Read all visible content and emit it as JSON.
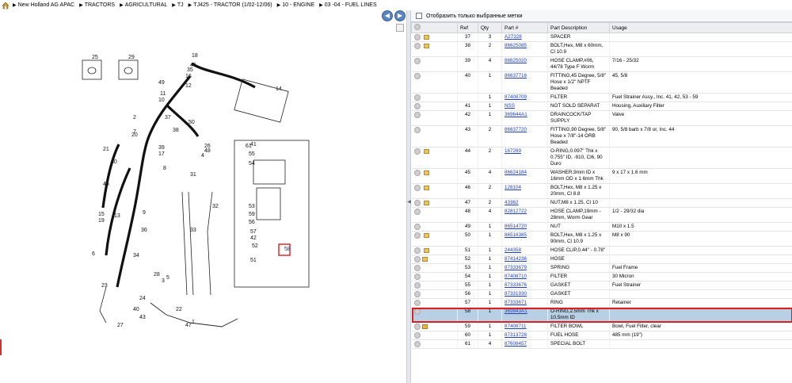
{
  "breadcrumbs": [
    "New Holland AG APAC",
    "TRACTORS",
    "AGRICULTURAL",
    "TJ",
    "TJ425 - TRACTOR (1/02-12/06)",
    "10 - ENGINE",
    "03 -04 - FUEL LINES"
  ],
  "filter": {
    "label": "Отобразить только выбранные метки"
  },
  "table": {
    "headers": [
      "Ref",
      "Qty",
      "Part #",
      "Part Description",
      "Usage"
    ],
    "rows": [
      {
        "icons": [
          "dot",
          "swap",
          "box"
        ],
        "ref": "37",
        "qty": "3",
        "part": "A27328",
        "desc": "SPACER",
        "usage": ""
      },
      {
        "icons": [
          "dot",
          "swap",
          "box"
        ],
        "ref": "38",
        "qty": "2",
        "part": "86625085",
        "desc": "BOLT,Hex, M8 x 60mm, Cl 10.9",
        "usage": ""
      },
      {
        "icons": [
          "dot",
          "arrow"
        ],
        "ref": "39",
        "qty": "4",
        "part": "86625020",
        "desc": "HOSE CLAMP,#06, 44/78 Type F Worm",
        "usage": "7/16 - 25/32"
      },
      {
        "icons": [
          "dot",
          "arrow"
        ],
        "ref": "40",
        "qty": "1",
        "part": "86637716",
        "desc": "FITTING,45 Degree, 5/8\" Hose x 1/2\" NPTF Beaded",
        "usage": "45, 5/8"
      },
      {
        "icons": [
          "dot",
          "arrow"
        ],
        "ref": "",
        "qty": "1",
        "part": "87408709",
        "desc": "FILTER",
        "usage": "Fuel Strainer Assy., Inc. 41, 42, 53 - 59"
      },
      {
        "icons": [
          "dot"
        ],
        "ref": "41",
        "qty": "1",
        "part": "NSS",
        "desc": "NOT SOLD SEPARAT",
        "usage": "Housing, Auxiliary Filter"
      },
      {
        "icons": [
          "dot",
          "swap"
        ],
        "ref": "42",
        "qty": "1",
        "part": "369644A1",
        "desc": "DRAINCOCK/TAP SUPPLY",
        "usage": "Valve"
      },
      {
        "icons": [
          "dot",
          "arrow"
        ],
        "ref": "43",
        "qty": "2",
        "part": "86637720",
        "desc": "FITTING,90 Degree, 5/8\" Hose x 7/8\"-14 ORB Beaded",
        "usage": "90, 5/8 barb x 7/8 or, Inc. 44"
      },
      {
        "icons": [
          "dot",
          "swap",
          "box"
        ],
        "ref": "44",
        "qty": "2",
        "part": "167269",
        "desc": "O-RING,0.097\" Thk x 0.755\" ID, -910, Cl6, 90 Duro",
        "usage": ""
      },
      {
        "icons": [
          "dot",
          "swap",
          "box"
        ],
        "ref": "45",
        "qty": "4",
        "part": "86624184",
        "desc": "WASHER,9mm ID x 16mm OD x 1.6mm Thk",
        "usage": "9 x 17 x 1.6 mm"
      },
      {
        "icons": [
          "dot",
          "swap",
          "box"
        ],
        "ref": "46",
        "qty": "2",
        "part": "128104",
        "desc": "BOLT,Hex, M8 x 1.25 x 20mm, Cl 8.8",
        "usage": ""
      },
      {
        "icons": [
          "dot",
          "swap",
          "box"
        ],
        "ref": "47",
        "qty": "2",
        "part": "43362",
        "desc": "NUT,M8 x 1.25, Cl 10",
        "usage": ""
      },
      {
        "icons": [
          "dot",
          "swap",
          "arrow"
        ],
        "ref": "48",
        "qty": "4",
        "part": "82812722",
        "desc": "HOSE CLAMP,19mm - 28mm, Worm Gear",
        "usage": "1/2 - 29/32 dia"
      },
      {
        "icons": [
          "dot",
          "swap",
          "arrow"
        ],
        "ref": "49",
        "qty": "1",
        "part": "86514720",
        "desc": "NUT",
        "usage": "M10 x 1.5"
      },
      {
        "icons": [
          "dot",
          "swap",
          "box"
        ],
        "ref": "50",
        "qty": "1",
        "part": "86516385",
        "desc": "BOLT,Hex, M8 x 1.25 x 90mm, Cl 10.9",
        "usage": "M8 x 90"
      },
      {
        "icons": [
          "dot",
          "swap",
          "box"
        ],
        "ref": "51",
        "qty": "1",
        "part": "244358",
        "desc": "HOSE CLIP,0.44\" - 0.78\"",
        "usage": ""
      },
      {
        "icons": [
          "dot",
          "box"
        ],
        "ref": "52",
        "qty": "1",
        "part": "87414236",
        "desc": "HOSE",
        "usage": ""
      },
      {
        "icons": [
          "dot"
        ],
        "ref": "53",
        "qty": "1",
        "part": "87333679",
        "desc": "SPRING",
        "usage": "Fuel Frame"
      },
      {
        "icons": [
          "dot",
          "arrow"
        ],
        "ref": "54",
        "qty": "1",
        "part": "87408710",
        "desc": "FILTER",
        "usage": "30 Micron"
      },
      {
        "icons": [
          "dot"
        ],
        "ref": "55",
        "qty": "1",
        "part": "87333676",
        "desc": "GASKET",
        "usage": "Fuel Strainer"
      },
      {
        "icons": [
          "dot"
        ],
        "ref": "56",
        "qty": "1",
        "part": "87331930",
        "desc": "GASKET",
        "usage": ""
      },
      {
        "icons": [
          "dot"
        ],
        "ref": "57",
        "qty": "1",
        "part": "87333671",
        "desc": "RING",
        "usage": "Retainer"
      },
      {
        "icons": [
          "dot",
          "swap"
        ],
        "ref": "58",
        "qty": "1",
        "part": "369843A1",
        "desc": "O-RING,2.5mm Thk x 10.5mm ID",
        "usage": "",
        "selected": true
      },
      {
        "icons": [
          "dot",
          "folder",
          "arrow"
        ],
        "ref": "59",
        "qty": "1",
        "part": "87408711",
        "desc": "FILTER BOWL",
        "usage": "Bowl, Fuel Filter, clear"
      },
      {
        "icons": [
          "dot"
        ],
        "ref": "60",
        "qty": "1",
        "part": "87313728",
        "desc": "FUEL HOSE",
        "usage": "485 mm (19\")"
      },
      {
        "icons": [
          "dot"
        ],
        "ref": "61",
        "qty": "4",
        "part": "87608457",
        "desc": "SPECIAL BOLT",
        "usage": ""
      }
    ]
  },
  "diagram": {
    "callouts": [
      "25",
      "29",
      "18",
      "45",
      "35",
      "14",
      "16",
      "12",
      "11",
      "10",
      "49",
      "37",
      "50",
      "2",
      "7",
      "38",
      "39",
      "17",
      "26",
      "48",
      "4",
      "21",
      "30",
      "20",
      "46",
      "8",
      "15",
      "19",
      "9",
      "31",
      "32",
      "13",
      "6",
      "36",
      "28",
      "34",
      "5",
      "23",
      "22",
      "24",
      "41",
      "1",
      "33",
      "47",
      "27",
      "3",
      "40",
      "43",
      "61",
      "55",
      "54",
      "53",
      "59",
      "56",
      "57",
      "42",
      "52",
      "51",
      "58"
    ],
    "highlighted": "58"
  }
}
